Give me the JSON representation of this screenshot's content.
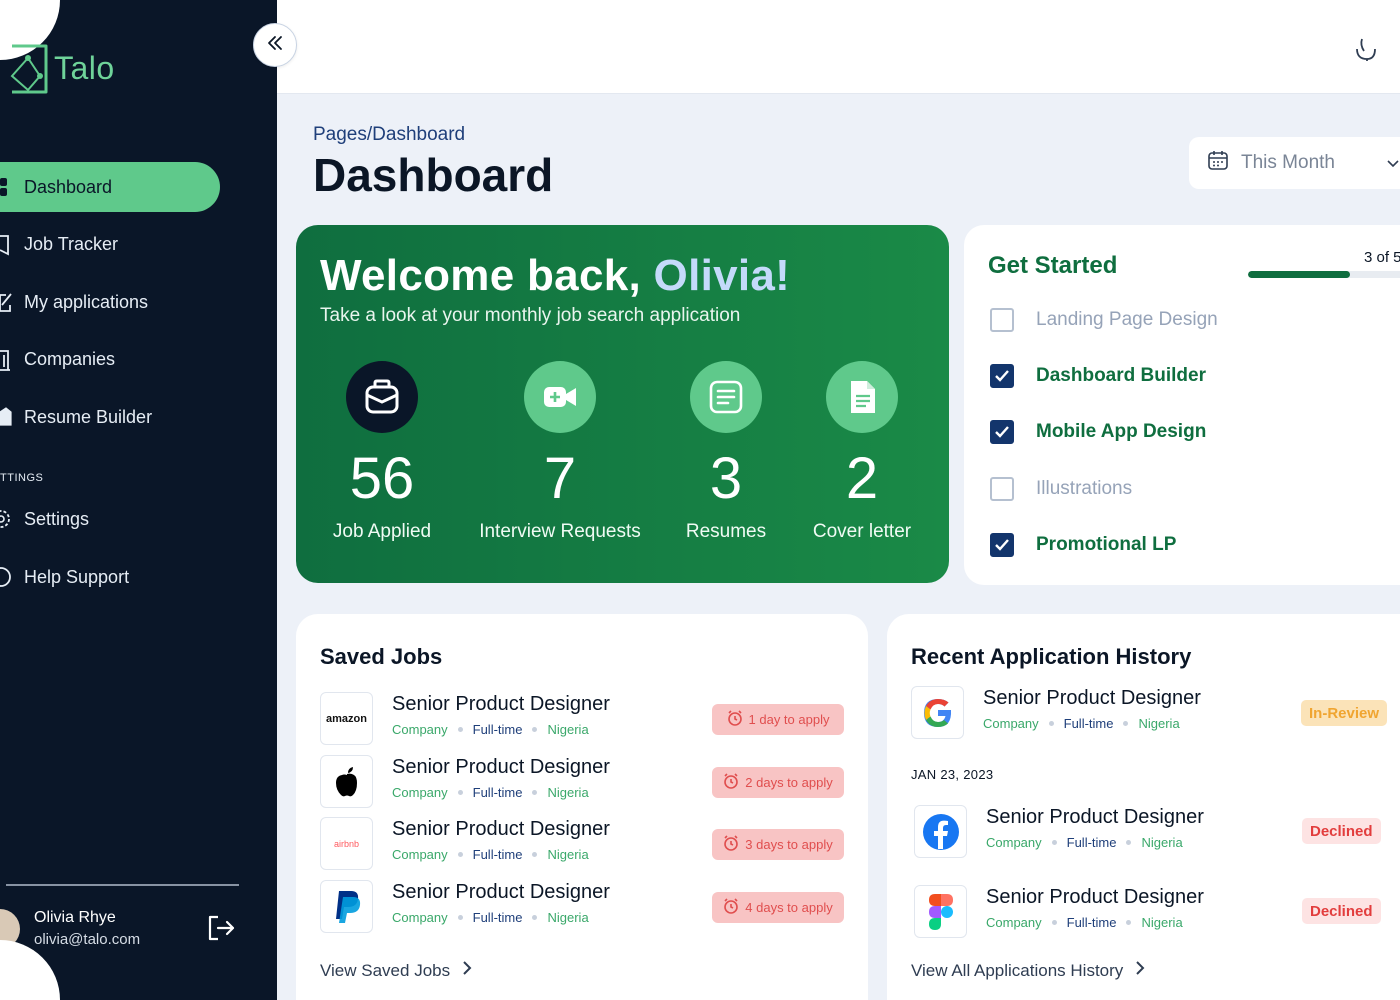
{
  "app": {
    "name": "Talo"
  },
  "sidebar": {
    "items": [
      {
        "label": "Dashboard",
        "icon": "grid-icon",
        "active": true
      },
      {
        "label": "Job Tracker",
        "icon": "bookmark-icon",
        "active": false
      },
      {
        "label": "My applications",
        "icon": "edit-icon",
        "active": false
      },
      {
        "label": "Companies",
        "icon": "building-icon",
        "active": false
      },
      {
        "label": "Resume Builder",
        "icon": "file-icon",
        "active": false
      }
    ],
    "settings_heading": "TTINGS",
    "settings_items": [
      {
        "label": "Settings",
        "icon": "gear-icon"
      },
      {
        "label": "Help Support",
        "icon": "help-icon"
      }
    ],
    "profile": {
      "name": "Olivia Rhye",
      "email": "olivia@talo.com"
    }
  },
  "header": {
    "breadcrumb": "Pages/Dashboard",
    "title": "Dashboard",
    "period_select": "This Month"
  },
  "welcome": {
    "title_prefix": "Welcome back,",
    "title_name": "Olivia!",
    "subtitle": "Take a look at your monthly job search application",
    "stats": [
      {
        "value": "56",
        "label": "Job Applied",
        "icon": "briefcase-icon",
        "color": "#0a1628"
      },
      {
        "value": "7",
        "label": "Interview Requests",
        "icon": "video-icon",
        "color": "#5fc98b"
      },
      {
        "value": "3",
        "label": "Resumes",
        "icon": "document-icon",
        "color": "#5fc98b"
      },
      {
        "value": "2",
        "label": "Cover letter",
        "icon": "page-icon",
        "color": "#5fc98b"
      }
    ]
  },
  "get_started": {
    "title": "Get Started",
    "progress": 0.6,
    "progress_label": "3 of 5",
    "tasks": [
      {
        "label": "Landing Page Design",
        "done": false
      },
      {
        "label": "Dashboard Builder",
        "done": true
      },
      {
        "label": "Mobile App Design",
        "done": true
      },
      {
        "label": "Illustrations",
        "done": false
      },
      {
        "label": "Promotional LP",
        "done": true
      }
    ]
  },
  "saved_jobs": {
    "title": "Saved Jobs",
    "jobs": [
      {
        "title": "Senior Product Designer",
        "company": "Company",
        "type": "Full-time",
        "location": "Nigeria",
        "deadline": "1 day to apply",
        "logo": "amazon-logo"
      },
      {
        "title": "Senior Product Designer",
        "company": "Company",
        "type": "Full-time",
        "location": "Nigeria",
        "deadline": "2 days to apply",
        "logo": "apple-logo"
      },
      {
        "title": "Senior Product Designer",
        "company": "Company",
        "type": "Full-time",
        "location": "Nigeria",
        "deadline": "3 days to apply",
        "logo": "airbnb-logo"
      },
      {
        "title": "Senior Product Designer",
        "company": "Company",
        "type": "Full-time",
        "location": "Nigeria",
        "deadline": "4 days to apply",
        "logo": "paypal-logo"
      }
    ],
    "link": "View Saved Jobs",
    "amazon_text": "amazon",
    "airbnb_text": "airbnb"
  },
  "history": {
    "title": "Recent Application History",
    "date": "JAN 23, 2023",
    "items": [
      {
        "title": "Senior Product Designer",
        "company": "Company",
        "type": "Full-time",
        "location": "Nigeria",
        "status": "In-Review",
        "logo": "google-logo"
      },
      {
        "title": "Senior Product Designer",
        "company": "Company",
        "type": "Full-time",
        "location": "Nigeria",
        "status": "Declined",
        "logo": "facebook-logo"
      },
      {
        "title": "Senior Product Designer",
        "company": "Company",
        "type": "Full-time",
        "location": "Nigeria",
        "status": "Declined",
        "logo": "figma-logo"
      }
    ],
    "link": "View All Applications History"
  },
  "colors": {
    "sidebar_bg": "#0a1628",
    "accent": "#5fc98b",
    "primary_green": "#0f6e3f",
    "navy": "#13356c",
    "review": "#f0a531",
    "declined": "#e23d3d"
  }
}
